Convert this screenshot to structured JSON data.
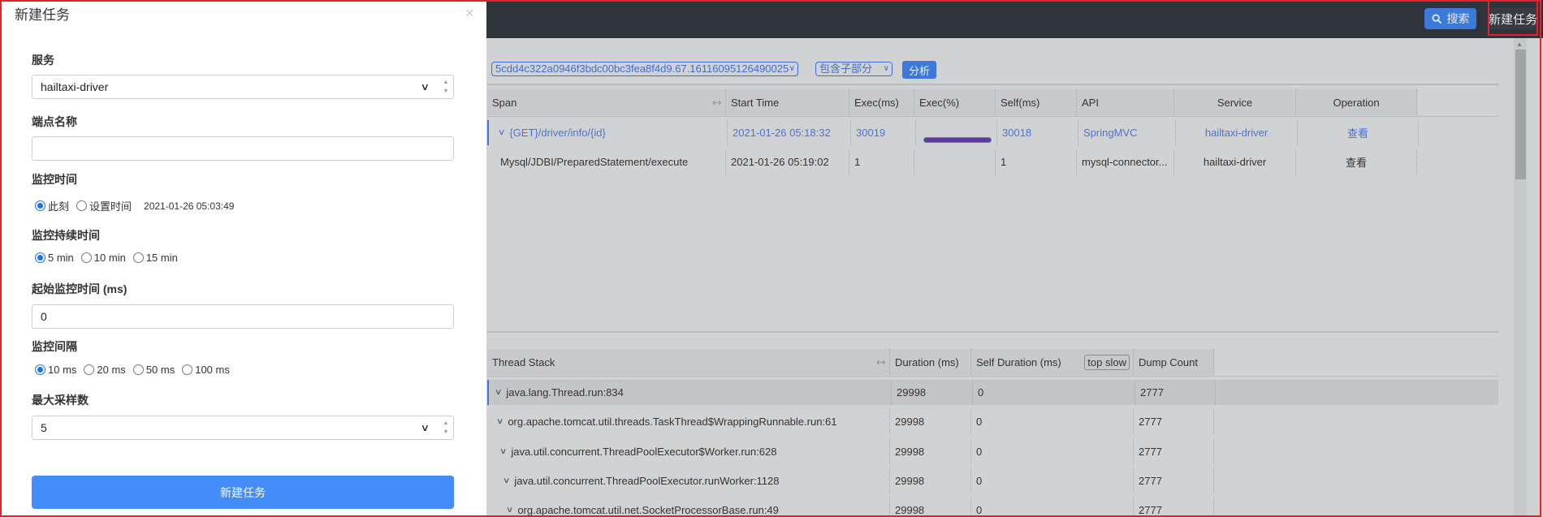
{
  "topbar": {
    "search_label": "搜索",
    "new_task_label": "新建任务"
  },
  "toolbar": {
    "trace_id": "5cdd4c322a0946f3bdc00bc3fea8f4d9.67.16116095126490025",
    "include_mode": "包含子部分",
    "analyze_label": "分析"
  },
  "span_table": {
    "columns": [
      "Span",
      "Start Time",
      "Exec(ms)",
      "Exec(%)",
      "Self(ms)",
      "API",
      "Service",
      "Operation"
    ],
    "rows": [
      {
        "span": "{GET}/driver/info/{id}",
        "start_time": "2021-01-26 05:18:32",
        "exec_ms": "30019",
        "exec_pct": 1.0,
        "self_ms": "30018",
        "api": "SpringMVC",
        "service": "hailtaxi-driver",
        "operation": "查看"
      },
      {
        "span": "Mysql/JDBI/PreparedStatement/execute",
        "start_time": "2021-01-26 05:19:02",
        "exec_ms": "1",
        "exec_pct": 0.0,
        "self_ms": "1",
        "api": "mysql-connector...",
        "service": "hailtaxi-driver",
        "operation": "查看"
      }
    ]
  },
  "thread_table": {
    "columns": [
      "Thread Stack",
      "Duration (ms)",
      "Self Duration (ms)",
      "Dump Count"
    ],
    "top_slow_label": "top slow",
    "rows": [
      {
        "stack": "java.lang.Thread.run:834",
        "duration": "29998",
        "self_duration": "0",
        "dump_count": "2777"
      },
      {
        "stack": "org.apache.tomcat.util.threads.TaskThread$WrappingRunnable.run:61",
        "duration": "29998",
        "self_duration": "0",
        "dump_count": "2777"
      },
      {
        "stack": "java.util.concurrent.ThreadPoolExecutor$Worker.run:628",
        "duration": "29998",
        "self_duration": "0",
        "dump_count": "2777"
      },
      {
        "stack": "java.util.concurrent.ThreadPoolExecutor.runWorker:1128",
        "duration": "29998",
        "self_duration": "0",
        "dump_count": "2777"
      },
      {
        "stack": "org.apache.tomcat.util.net.SocketProcessorBase.run:49",
        "duration": "29998",
        "self_duration": "0",
        "dump_count": "2777"
      }
    ]
  },
  "modal": {
    "title": "新建任务",
    "close_icon": "×",
    "service_label": "服务",
    "service_value": "hailtaxi-driver",
    "endpoint_label": "端点名称",
    "endpoint_value": "",
    "monitor_time_label": "监控时间",
    "monitor_time_options": [
      "此刻",
      "设置时间"
    ],
    "monitor_time_selected": "此刻",
    "monitor_time_value": "2021-01-26 05:03:49",
    "duration_label": "监控持续时间",
    "duration_options": [
      "5 min",
      "10 min",
      "15 min"
    ],
    "duration_selected": "5 min",
    "start_time_label": "起始监控时间 (ms)",
    "start_time_value": "0",
    "interval_label": "监控间隔",
    "interval_options": [
      "10 ms",
      "20 ms",
      "50 ms",
      "100 ms"
    ],
    "interval_selected": "10 ms",
    "max_samples_label": "最大采样数",
    "max_samples_value": "5",
    "submit_label": "新建任务"
  },
  "colors": {
    "accent": "#3b7ad8",
    "submit": "#458cfb",
    "topbar": "#2f333b",
    "highlight": "#e8202a",
    "link": "#4a72d4",
    "progress": "#5d3a9c"
  }
}
